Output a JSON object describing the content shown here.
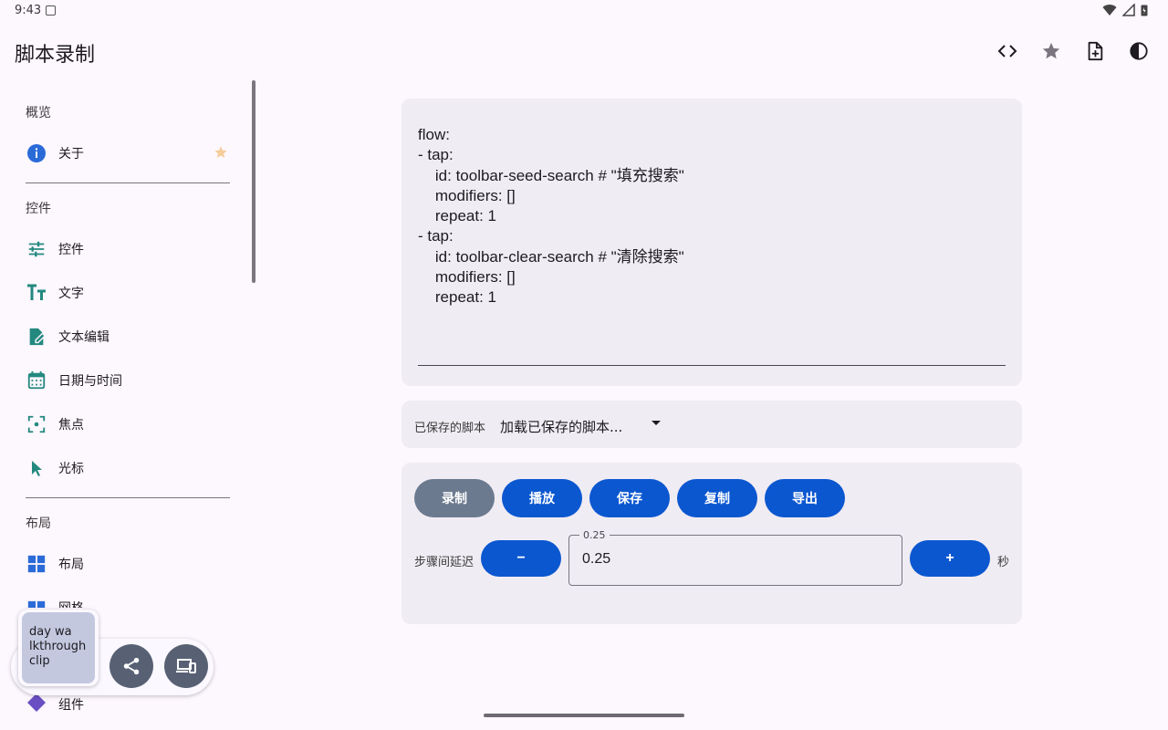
{
  "status_bar": {
    "time": "9:43"
  },
  "app_bar": {
    "title": "脚本录制",
    "actions": [
      "code-icon",
      "star-icon",
      "note-add-icon",
      "contrast-icon"
    ]
  },
  "sidebar": {
    "sections": [
      {
        "title": "概览",
        "items": [
          {
            "label": "关于",
            "icon": "info-icon",
            "starred": true
          }
        ]
      },
      {
        "title": "控件",
        "items": [
          {
            "label": "控件",
            "icon": "tune-icon"
          },
          {
            "label": "文字",
            "icon": "text-fields-icon"
          },
          {
            "label": "文本编辑",
            "icon": "edit-note-icon"
          },
          {
            "label": "日期与时间",
            "icon": "calendar-icon"
          },
          {
            "label": "焦点",
            "icon": "focus-icon"
          },
          {
            "label": "光标",
            "icon": "cursor-icon"
          }
        ]
      },
      {
        "title": "布局",
        "items": [
          {
            "label": "布局",
            "icon": "dashboard-icon"
          },
          {
            "label": "网格",
            "icon": "grid-icon"
          }
        ]
      }
    ],
    "partial_bottom_label": "组件"
  },
  "script_editor": {
    "content": "flow:\n- tap:\n    id: toolbar-seed-search # \"填充搜索\"\n    modifiers: []\n    repeat: 1\n- tap:\n    id: toolbar-clear-search # \"清除搜索\"\n    modifiers: []\n    repeat: 1"
  },
  "saved_scripts": {
    "label": "已保存的脚本",
    "selected": "加载已保存的脚本..."
  },
  "controls": {
    "buttons": [
      {
        "label": "录制",
        "style": "gray"
      },
      {
        "label": "播放",
        "style": "primary"
      },
      {
        "label": "保存",
        "style": "primary"
      },
      {
        "label": "复制",
        "style": "primary"
      },
      {
        "label": "导出",
        "style": "primary"
      }
    ],
    "delay_label": "步骤间延迟",
    "decrement": "−",
    "increment": "+",
    "field_label": "0.25",
    "field_value": "0.25",
    "unit": "秒"
  },
  "floating_recorder": {
    "clip_text": "day wa\nlkthrough\nclip",
    "actions": [
      "share-icon",
      "devices-icon"
    ]
  },
  "colors": {
    "background": "#fdf7fe",
    "card": "#f0ecf3",
    "primary": "#0b57d0",
    "record_gray": "#6b7a8f",
    "icon_teal": "#23897f",
    "icon_blue": "#2b6bd8"
  }
}
